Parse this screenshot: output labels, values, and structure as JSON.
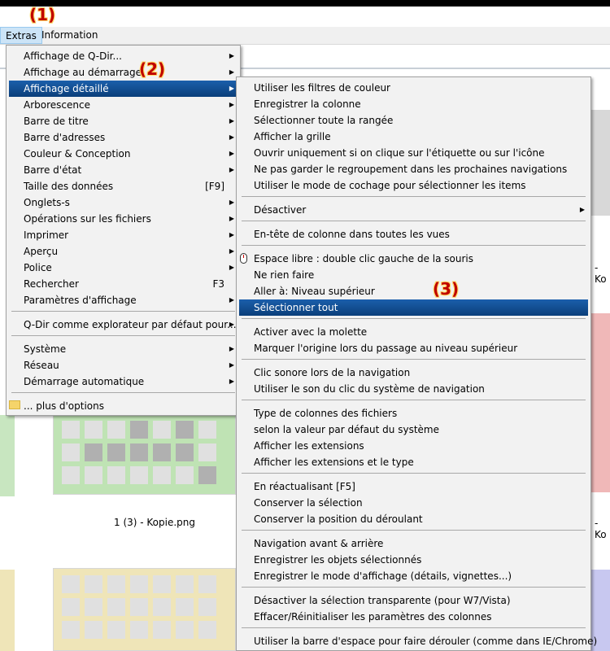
{
  "annotations": [
    "(1)",
    "(2)",
    "(3)"
  ],
  "menubar": {
    "extras": "Extras",
    "information": "Information"
  },
  "files": {
    "caption_left": "1 (3) - Kopie.png",
    "caption_right_1": "- Ko",
    "caption_right_2": "- Ko"
  },
  "main_menu": {
    "items": [
      {
        "label": "Affichage de Q-Dir..."
      },
      {
        "label": "Affichage au démarrage"
      },
      {
        "label": "Affichage détaillé"
      },
      {
        "label": "Arborescence"
      },
      {
        "label": "Barre de titre"
      },
      {
        "label": "Barre d'adresses"
      },
      {
        "label": "Couleur & Conception"
      },
      {
        "label": "Barre d'état"
      },
      {
        "label": "Taille des données",
        "shortcut": "[F9]"
      },
      {
        "label": "Onglets-s"
      },
      {
        "label": "Opérations sur les fichiers"
      },
      {
        "label": "Imprimer"
      },
      {
        "label": "Aperçu"
      },
      {
        "label": "Police"
      },
      {
        "label": "Rechercher",
        "shortcut": "F3"
      },
      {
        "label": "Paramètres d'affichage"
      },
      {
        "label": "Q-Dir comme explorateur par défaut pour..."
      },
      {
        "label": "Système"
      },
      {
        "label": "Réseau"
      },
      {
        "label": "Démarrage automatique"
      },
      {
        "label": "... plus d'options"
      }
    ]
  },
  "sub_menu": {
    "items": [
      {
        "label": "Utiliser les filtres de couleur"
      },
      {
        "label": "Enregistrer la colonne"
      },
      {
        "label": "Sélectionner toute la rangée"
      },
      {
        "label": "Afficher la grille"
      },
      {
        "label": "Ouvrir uniquement si on clique sur l'étiquette ou sur l'icône"
      },
      {
        "label": "Ne pas garder le regroupement dans les prochaines navigations"
      },
      {
        "label": "Utiliser le mode de cochage pour sélectionner les items"
      },
      {
        "label": "Désactiver"
      },
      {
        "label": "En-tête de colonne dans toutes les vues"
      },
      {
        "label": "Espace libre : double clic gauche de la souris"
      },
      {
        "label": "Ne rien faire"
      },
      {
        "label": "Aller à: Niveau supérieur"
      },
      {
        "label": "Sélectionner tout"
      },
      {
        "label": "Activer avec la molette"
      },
      {
        "label": "Marquer l'origine lors du passage au niveau supérieur"
      },
      {
        "label": "Clic sonore lors de la navigation"
      },
      {
        "label": "Utiliser le son du clic du système de navigation"
      },
      {
        "label": "Type de colonnes des fichiers"
      },
      {
        "label": "selon la valeur par défaut du système"
      },
      {
        "label": "Afficher les extensions"
      },
      {
        "label": "Afficher les extensions et le type"
      },
      {
        "label": "En réactualisant [F5]"
      },
      {
        "label": "Conserver la sélection"
      },
      {
        "label": "Conserver la position du déroulant"
      },
      {
        "label": "Navigation avant & arrière"
      },
      {
        "label": "Enregistrer les objets sélectionnés"
      },
      {
        "label": "Enregistrer le mode d'affichage (détails, vignettes...)"
      },
      {
        "label": "Désactiver la sélection transparente (pour W7/Vista)"
      },
      {
        "label": "Effacer/Réinitialiser les paramètres des colonnes"
      },
      {
        "label": "Utiliser la barre d'espace pour faire dérouler (comme dans IE/Chrome)"
      }
    ]
  }
}
